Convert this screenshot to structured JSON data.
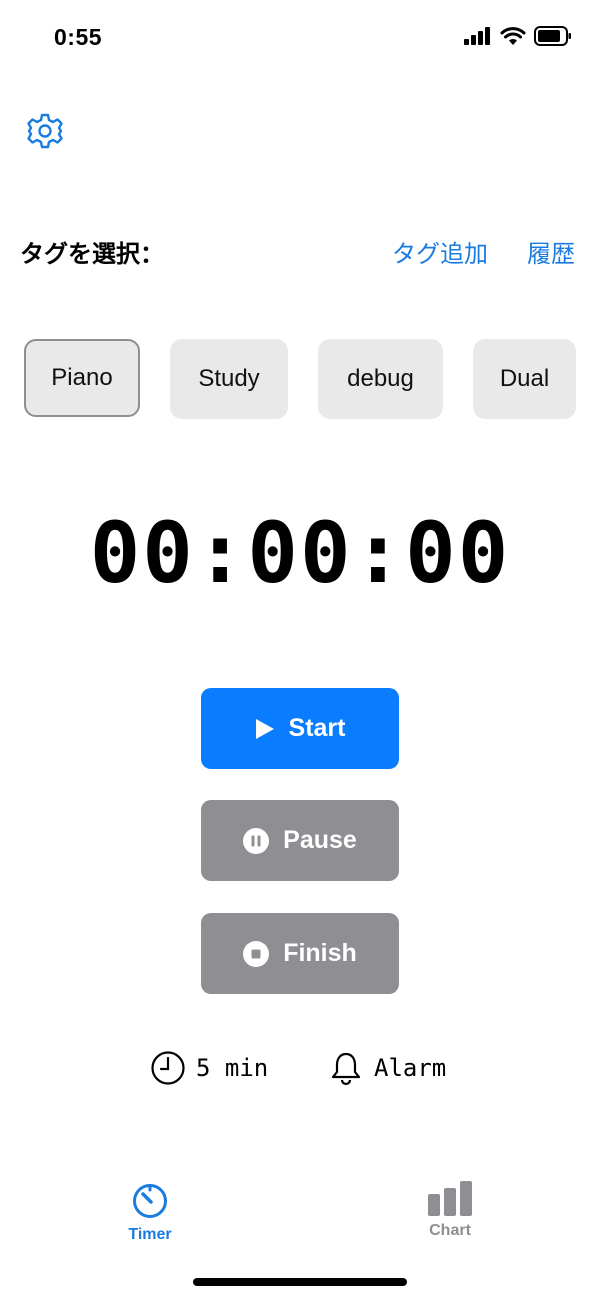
{
  "status_bar": {
    "time": "0:55"
  },
  "header": {
    "tag_prompt": "タグを選択：",
    "add_tag_link": "タグ追加",
    "history_link": "履歴"
  },
  "tags": [
    {
      "label": "Piano",
      "selected": true
    },
    {
      "label": "Study",
      "selected": false
    },
    {
      "label": "debug",
      "selected": false
    },
    {
      "label": "Dual",
      "selected": false
    }
  ],
  "timer": {
    "display": "00:00:00"
  },
  "controls": {
    "start_label": "Start",
    "pause_label": "Pause",
    "finish_label": "Finish"
  },
  "info": {
    "interval_label": "5 min",
    "alarm_label": "Alarm"
  },
  "tab_bar": {
    "timer_label": "Timer",
    "chart_label": "Chart"
  },
  "icons": {
    "settings": "gear-icon",
    "play": "play-icon",
    "pause": "pause-circle-icon",
    "stop": "stop-circle-icon",
    "clock": "clock-icon",
    "bell": "bell-icon",
    "timer_tab": "timer-icon",
    "chart_tab": "bar-chart-icon"
  },
  "colors": {
    "accent": "#0a7cff",
    "link": "#1a7ce0",
    "disabled_button": "#8e8e93",
    "tag_background": "#e9e9ea"
  }
}
